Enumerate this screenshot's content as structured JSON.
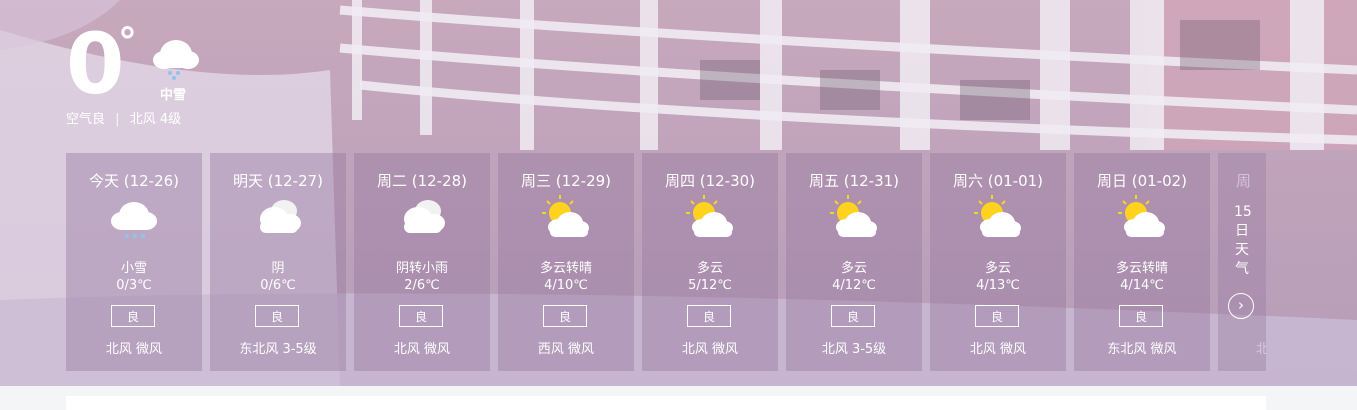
{
  "current": {
    "temperature": "0",
    "degree_symbol": "°",
    "condition": "中雪",
    "condition_icon": "snow-cloud-icon",
    "air_quality": "空气良",
    "separator": "|",
    "wind": "北风 4级"
  },
  "forecast": [
    {
      "date": "今天 (12-26)",
      "desc": "小雪",
      "range": "0/3℃",
      "aqi": "良",
      "wind": "北风 微风",
      "icon": "snow-cloud-icon"
    },
    {
      "date": "明天 (12-27)",
      "desc": "阴",
      "range": "0/6℃",
      "aqi": "良",
      "wind": "东北风 3-5级",
      "icon": "overcast-icon"
    },
    {
      "date": "周二 (12-28)",
      "desc": "阴转小雨",
      "range": "2/6℃",
      "aqi": "良",
      "wind": "北风 微风",
      "icon": "overcast-icon"
    },
    {
      "date": "周三 (12-29)",
      "desc": "多云转晴",
      "range": "4/10℃",
      "aqi": "良",
      "wind": "西风 微风",
      "icon": "partly-cloudy-icon"
    },
    {
      "date": "周四 (12-30)",
      "desc": "多云",
      "range": "5/12℃",
      "aqi": "良",
      "wind": "北风 微风",
      "icon": "partly-cloudy-icon"
    },
    {
      "date": "周五 (12-31)",
      "desc": "多云",
      "range": "4/12℃",
      "aqi": "良",
      "wind": "北风 3-5级",
      "icon": "partly-cloudy-icon"
    },
    {
      "date": "周六 (01-01)",
      "desc": "多云",
      "range": "4/13℃",
      "aqi": "良",
      "wind": "北风 微风",
      "icon": "partly-cloudy-icon"
    },
    {
      "date": "周日 (01-02)",
      "desc": "多云转晴",
      "range": "4/14℃",
      "aqi": "良",
      "wind": "东北风 微风",
      "icon": "partly-cloudy-icon"
    }
  ],
  "more": {
    "faded_label": "周",
    "vertical_label": [
      "15",
      "日",
      "天",
      "气"
    ],
    "arrow": "›",
    "faded_wind": "北"
  },
  "colors": {
    "card_bg": "#9d87a8",
    "sun": "#ffd21e",
    "text": "#ffffff",
    "snow_dots": "#8fc4ee"
  }
}
